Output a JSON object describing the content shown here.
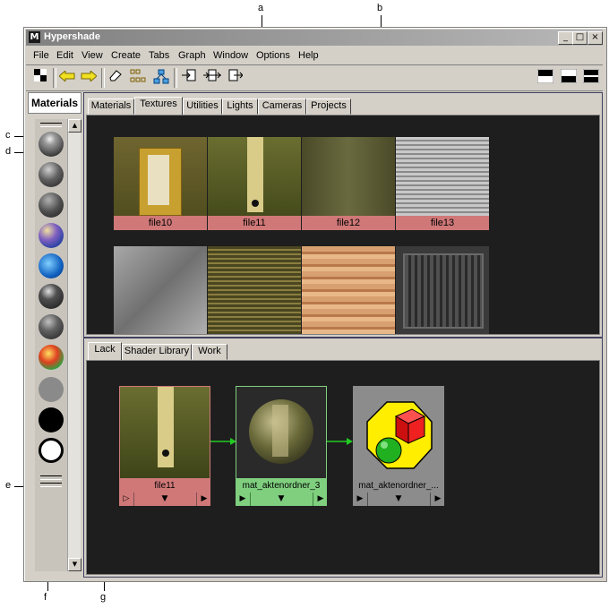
{
  "window": {
    "title": "Hypershade",
    "app_icon": "M",
    "controls": {
      "minimize": "_",
      "maximize": "□",
      "close": "×"
    }
  },
  "menubar": {
    "items": [
      "File",
      "Edit",
      "View",
      "Create",
      "Tabs",
      "Graph",
      "Window",
      "Options",
      "Help"
    ]
  },
  "toolbar": {
    "icons": [
      "checker-icon",
      "arrow-left-icon",
      "arrow-right-icon",
      "eraser-icon",
      "grid-layout-icon",
      "graph-network-icon",
      "input-connections-icon",
      "input-output-connections-icon",
      "output-connections-icon",
      "layout-top-icon",
      "layout-bottom-icon",
      "layout-split-icon"
    ]
  },
  "left_panel": {
    "title": "Materials",
    "swatch_icons": [
      "lambert-swatch",
      "blinn-swatch",
      "phong-swatch",
      "anisotropic-swatch",
      "ocean-shader-swatch",
      "phongE-swatch",
      "rampshader-swatch",
      "layered-shader-swatch",
      "surface-shader-swatch",
      "use-background-swatch",
      "shading-map-swatch"
    ]
  },
  "top_panel": {
    "tabs": [
      "Materials",
      "Textures",
      "Utilities",
      "Lights",
      "Cameras",
      "Projects"
    ],
    "active_tab": "Textures",
    "textures": [
      {
        "name": "file10"
      },
      {
        "name": "file11"
      },
      {
        "name": "file12"
      },
      {
        "name": "file13"
      }
    ]
  },
  "bottom_panel": {
    "tabs": [
      "Lack",
      "Shader Library",
      "Work"
    ],
    "active_tab": "Lack",
    "nodes": [
      {
        "name": "file11"
      },
      {
        "name": "mat_aktenordner_3"
      },
      {
        "name": "mat_aktenordner_..."
      }
    ]
  },
  "callouts": {
    "a": "a",
    "b": "b",
    "c": "c",
    "d": "d",
    "e": "e",
    "f": "f",
    "g": "g"
  },
  "colors": {
    "node_texture_label": "#d07878",
    "node_material_label": "#7fcf7f",
    "node_sg_label": "#8c8c8c",
    "connection": "#22cc22",
    "dark_bg": "#1e1e1e"
  }
}
